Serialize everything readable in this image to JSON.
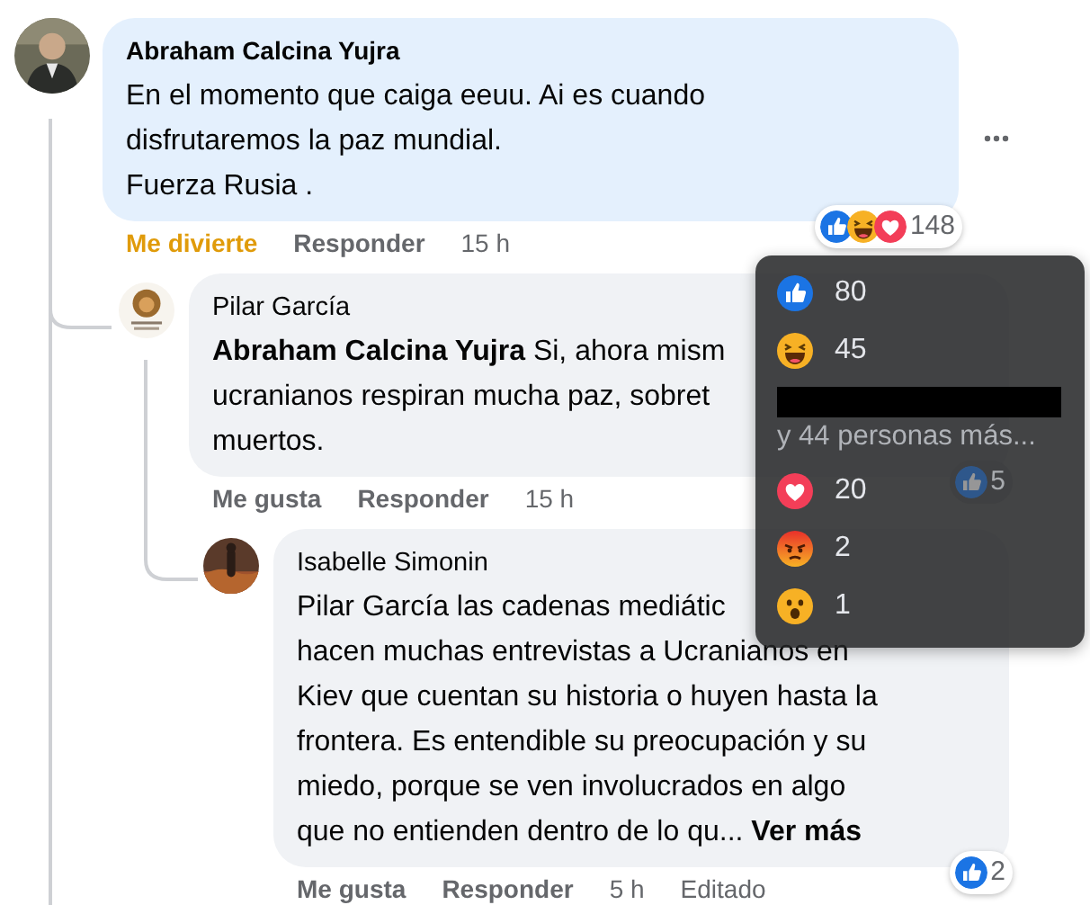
{
  "comments": [
    {
      "author": "Abraham Calcina Yujra",
      "highlighted": true,
      "lines": [
        "En el momento que caiga eeuu. Ai es cuando",
        "disfrutaremos la paz mundial.",
        "Fuerza Rusia ."
      ],
      "react": {
        "kind": "haha",
        "label": "Me divierte"
      },
      "reply": "Responder",
      "time": "15 h",
      "reactions": [
        {
          "kind": "like"
        },
        {
          "kind": "haha"
        },
        {
          "kind": "love"
        }
      ],
      "reaction_count": "148",
      "more_menu": true
    },
    {
      "author": "Pilar García",
      "highlighted": false,
      "lines": [
        "**Abraham Calcina Yujra** Si, ahora mism",
        "ucranianos respiran mucha paz, sobret",
        "muertos."
      ],
      "react": {
        "kind": "none",
        "label": "Me gusta"
      },
      "reply": "Responder",
      "time": "15 h",
      "reactions": [
        {
          "kind": "like"
        }
      ],
      "reaction_count": "5"
    },
    {
      "author": "Isabelle Simonin",
      "highlighted": false,
      "lines": [
        "Pilar García las cadenas mediátic",
        "hacen muchas entrevistas a Ucranianos en",
        "Kiev que cuentan su historia o huyen hasta la",
        "frontera. Es entendible su preocupación y su",
        "miedo, porque se ven involucrados en algo",
        "que no entienden dentro de lo qu... **Ver más**"
      ],
      "react": {
        "kind": "none",
        "label": "Me gusta"
      },
      "reply": "Responder",
      "time": "5 h",
      "edited": "Editado",
      "reactions": [
        {
          "kind": "like"
        }
      ],
      "reaction_count": "2"
    }
  ],
  "tooltip": {
    "items": [
      {
        "kind": "like",
        "count": "80"
      },
      {
        "kind": "haha",
        "count": "45"
      },
      {
        "kind": "redacted"
      },
      {
        "kind": "more",
        "text": "y 44 personas más..."
      },
      {
        "kind": "love",
        "count": "20"
      },
      {
        "kind": "angry",
        "count": "2"
      },
      {
        "kind": "wow",
        "count": "1"
      }
    ]
  }
}
